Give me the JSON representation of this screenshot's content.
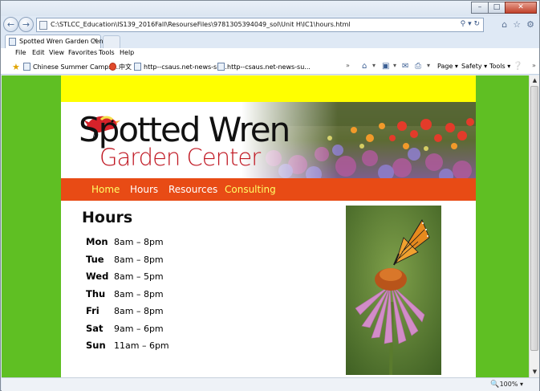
{
  "browser": {
    "url": "C:\\STLCC_Education\\IS139_2016Fall\\ResourseFiles\\9781305394049_sol\\Unit H\\IC1\\hours.html",
    "tab_title": "Spotted Wren Garden Cent...",
    "menus": [
      "File",
      "Edit",
      "View",
      "Favorites",
      "Tools",
      "Help"
    ],
    "favorites": [
      "Chinese Summer Camps ...",
      "中文",
      "http--csaus.net-news-su...",
      "http--csaus.net-news-su..."
    ],
    "commands": [
      "Page",
      "Safety",
      "Tools"
    ],
    "zoom": "100%"
  },
  "site": {
    "logo_line1": "Spotted Wren",
    "logo_line2": "Garden Center",
    "nav": [
      {
        "label": "Home",
        "active": true
      },
      {
        "label": "Hours",
        "active": false
      },
      {
        "label": "Resources",
        "active": false
      },
      {
        "label": "Consulting",
        "active": true
      }
    ],
    "heading": "Hours",
    "hours": [
      {
        "day": "Mon",
        "time": "8am – 8pm"
      },
      {
        "day": "Tue",
        "time": "8am – 8pm"
      },
      {
        "day": "Wed",
        "time": "8am – 5pm"
      },
      {
        "day": "Thu",
        "time": "8am – 8pm"
      },
      {
        "day": "Fri",
        "time": "8am – 8pm"
      },
      {
        "day": "Sat",
        "time": "9am – 6pm"
      },
      {
        "day": "Sun",
        "time": "11am – 6pm"
      }
    ]
  },
  "colors": {
    "side_green": "#5fbf23",
    "top_yellow": "#ffff00",
    "nav_orange": "#e84b15",
    "logo_red": "#c01722"
  }
}
